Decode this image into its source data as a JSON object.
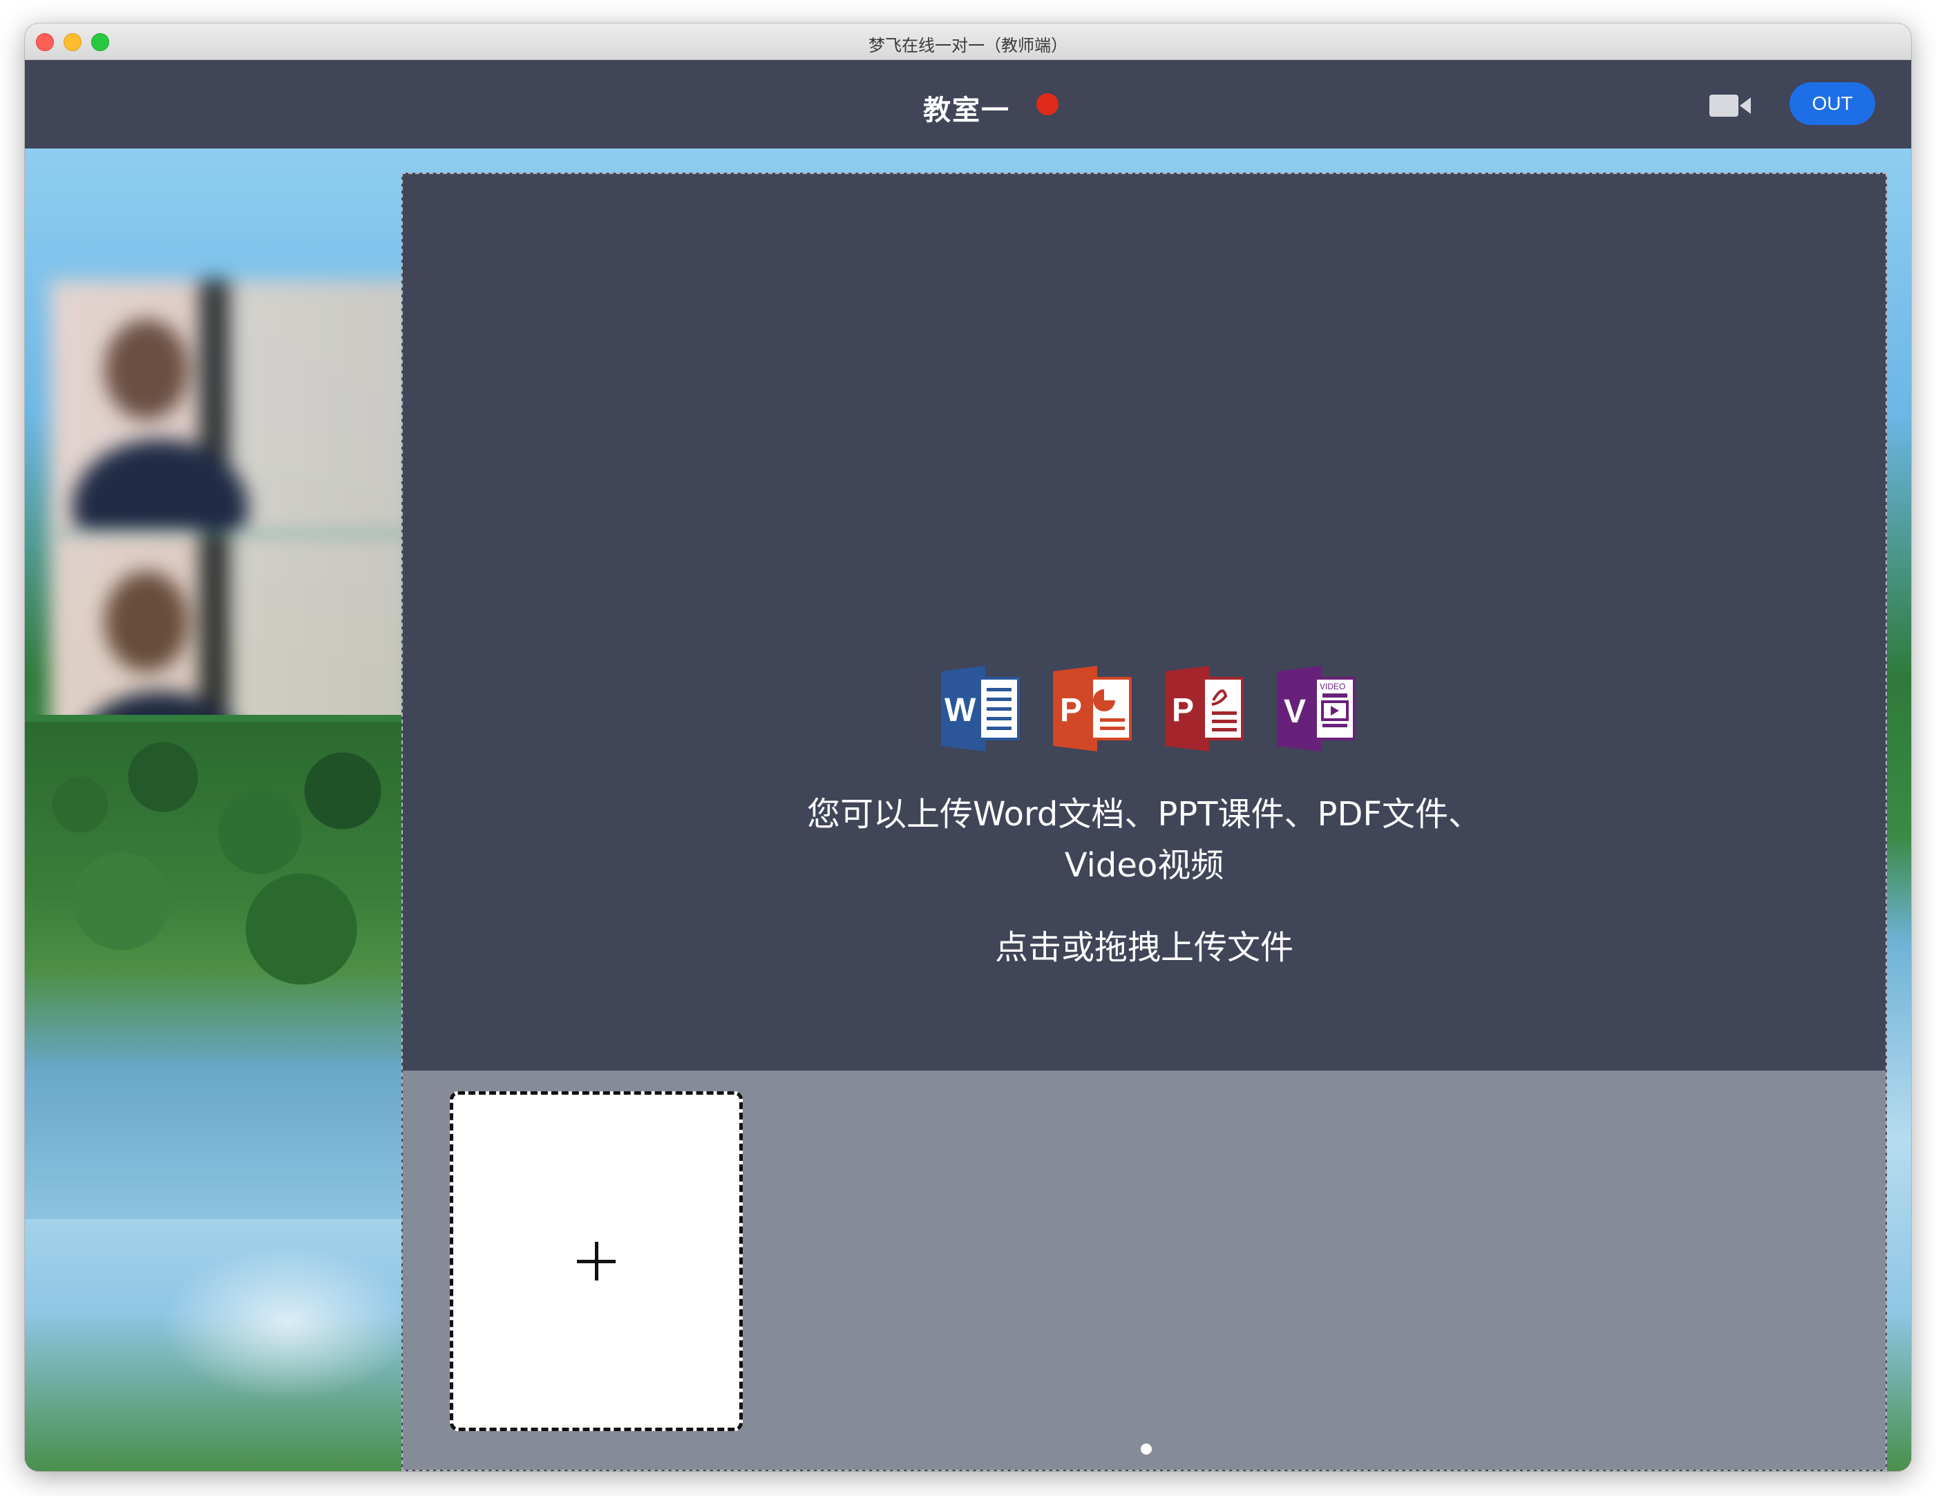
{
  "window": {
    "title": "梦飞在线一对一（教师端）"
  },
  "header": {
    "classroom_title": "教室一",
    "recording_status_color": "#e12b1a",
    "out_label": "OUT"
  },
  "upload": {
    "file_types": [
      {
        "name": "word-icon",
        "letter": "W",
        "color": "#2b579a"
      },
      {
        "name": "powerpoint-icon",
        "letter": "P",
        "color": "#d24726"
      },
      {
        "name": "pdf-icon",
        "letter": "P",
        "color": "#a4262c"
      },
      {
        "name": "video-icon",
        "letter": "V",
        "color": "#68217a",
        "tag": "VIDEO"
      }
    ],
    "description": "您可以上传Word文档、PPT课件、PDF文件、Video视频",
    "hint": "点击或拖拽上传文件"
  },
  "thumbnails": {
    "add_label": "+",
    "current_page_indicator": "dot"
  },
  "colors": {
    "header_bg": "#404558",
    "strip_bg": "#868b98",
    "accent_blue": "#1e6ee8"
  }
}
